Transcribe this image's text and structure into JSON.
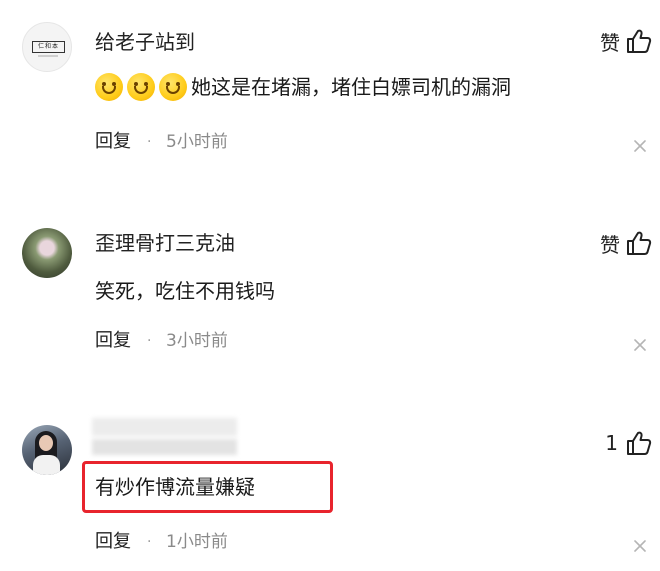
{
  "comments": [
    {
      "username": "给老子站到",
      "text": "她这是在堵漏，堵住白嫖司机的漏洞",
      "emoji_icon": "smile-emoji-icon",
      "emoji_count": 3,
      "like_label": "赞",
      "reply_label": "回复",
      "separator": "·",
      "time": "5小时前",
      "avatar_logo_text": "仁和本"
    },
    {
      "username": "歪理骨打三克油",
      "text": "笑死，吃住不用钱吗",
      "like_label": "赞",
      "reply_label": "回复",
      "separator": "·",
      "time": "3小时前"
    },
    {
      "username": "",
      "text": "有炒作博流量嫌疑",
      "like_count": "1",
      "reply_label": "回复",
      "separator": "·",
      "time": "1小时前",
      "highlight_color": "#e8242d"
    }
  ],
  "icons": {
    "like": "thumbs-up-icon",
    "close": "close-icon"
  }
}
